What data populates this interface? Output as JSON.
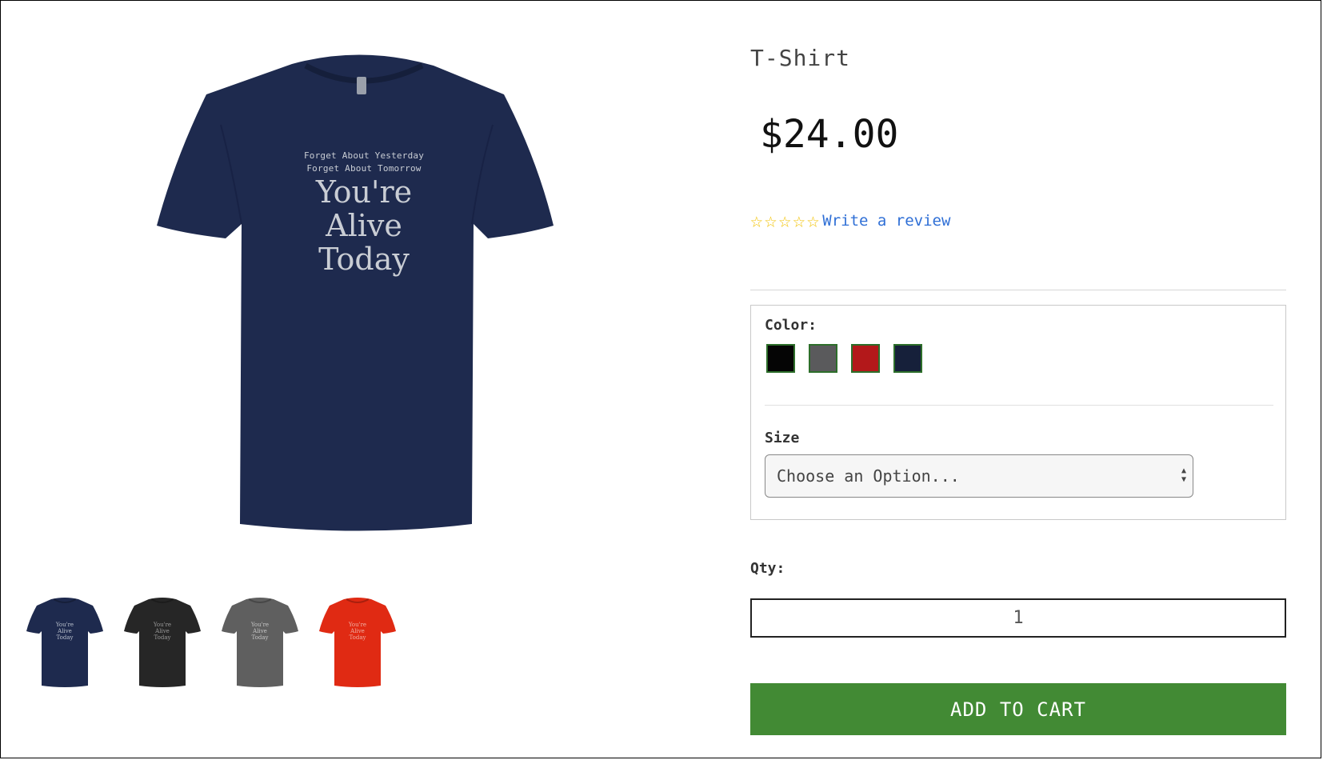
{
  "product": {
    "title": "T-Shirt",
    "price": "$24.00",
    "main_print": {
      "line1": "Forget About Yesterday",
      "line2": "Forget About Tomorrow",
      "line3": "You're",
      "line4": "Alive",
      "line5": "Today"
    }
  },
  "rating": {
    "stars": 0,
    "max_stars": 5,
    "star_glyph": "☆",
    "review_link": "Write a review"
  },
  "thumbnails": [
    {
      "color": "#1e2a4e",
      "print_color": "#b9c0cc",
      "print": [
        "You're",
        "Alive",
        "Today"
      ]
    },
    {
      "color": "#262626",
      "print_color": "#9a9a9a",
      "print": [
        "You're",
        "Alive",
        "Today"
      ]
    },
    {
      "color": "#5f5f5f",
      "print_color": "#c5c5c5",
      "print": [
        "You're",
        "Alive",
        "Today"
      ]
    },
    {
      "color": "#e02a13",
      "print_color": "#f0b0a4",
      "print": [
        "You're",
        "Alive",
        "Today"
      ]
    }
  ],
  "options": {
    "color_label": "Color:",
    "swatches": [
      "#050505",
      "#5a5a5c",
      "#b3181a",
      "#16203a"
    ],
    "size_label": "Size",
    "size_select_value": "Choose an Option..."
  },
  "quantity": {
    "label": "Qty:",
    "value": "1"
  },
  "cart": {
    "button_label": "ADD TO CART",
    "button_color": "#428a34"
  },
  "colors": {
    "shirt_main": "#1e2a4e",
    "link": "#2f6fd6",
    "star": "#f2c200"
  }
}
